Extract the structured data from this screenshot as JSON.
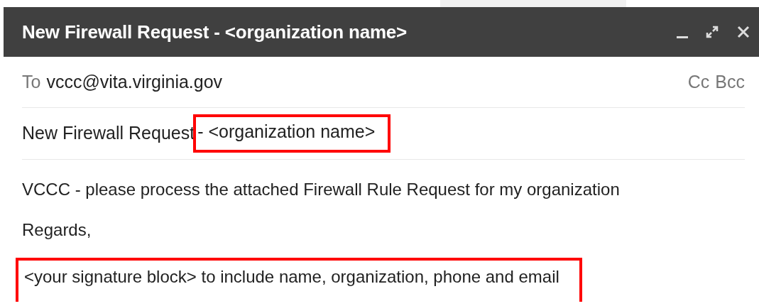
{
  "window": {
    "title": "New Firewall Request - <organization name>"
  },
  "recipients": {
    "to_label": "To",
    "to": "vccc@vita.virginia.gov",
    "cc": "Cc",
    "bcc": "Bcc"
  },
  "subject": [
    {
      "text": "New Firewall Request",
      "highlighted": false
    },
    {
      "text": "- <organization name>",
      "highlighted": true
    }
  ],
  "body": [
    {
      "text": "VCCC - please process the attached Firewall Rule Request for my organization",
      "highlighted": false
    },
    {
      "text": "Regards,",
      "highlighted": false
    },
    {
      "text": "<your signature block> to include name, organization, phone and email",
      "highlighted": true
    }
  ]
}
